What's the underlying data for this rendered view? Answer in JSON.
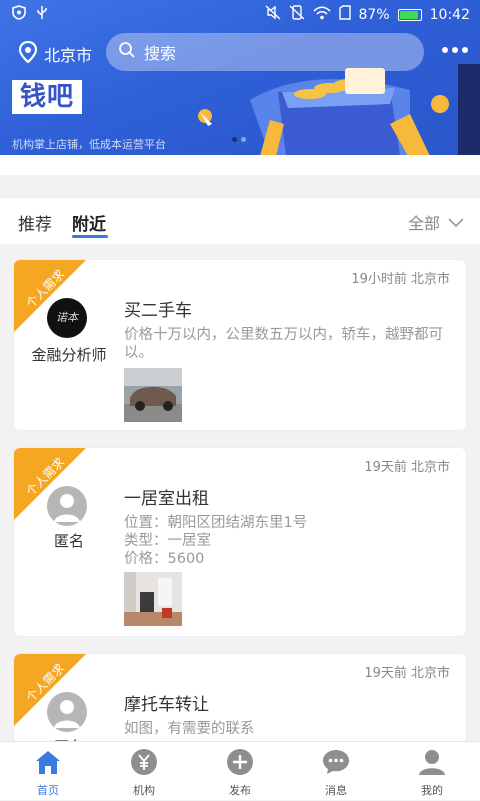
{
  "status_bar": {
    "battery_percent": "87%",
    "time": "10:42"
  },
  "header": {
    "city": "北京市",
    "search_placeholder": "搜索"
  },
  "banner": {
    "logo_text": "钱吧",
    "tagline": "机构掌上店铺，低成本运营平台"
  },
  "tabs": [
    {
      "label": "推荐"
    },
    {
      "label": "附近"
    }
  ],
  "active_tab": "附近",
  "filter": {
    "label": "全部"
  },
  "cards": [
    {
      "ribbon": "个人需求",
      "meta": "19小时前 北京市",
      "user": "金融分析师",
      "title": "买二手车",
      "desc": "价格十万以内，公里数五万以内，轿车，越野都可以。",
      "avatar_text": "诺本"
    },
    {
      "ribbon": "个人需求",
      "meta": "19天前 北京市",
      "user": "匿名",
      "title": "一居室出租",
      "desc_lines": [
        "位置：朝阳区团结湖东里1号",
        "类型：一居室",
        "价格：5600"
      ]
    },
    {
      "ribbon": "个人需求",
      "meta": "19天前 北京市",
      "user": "匿名",
      "title": "摩托车转让",
      "desc": "如图，有需要的联系"
    }
  ],
  "bottom_nav": [
    {
      "label": "首页",
      "icon": "home-icon"
    },
    {
      "label": "机构",
      "icon": "yen-icon"
    },
    {
      "label": "发布",
      "icon": "plus-icon"
    },
    {
      "label": "消息",
      "icon": "chat-icon"
    },
    {
      "label": "我的",
      "icon": "user-icon"
    }
  ],
  "colors": {
    "accent": "#3b7be0",
    "banner": "#2f60d8",
    "ribbon": "#f5a623"
  }
}
